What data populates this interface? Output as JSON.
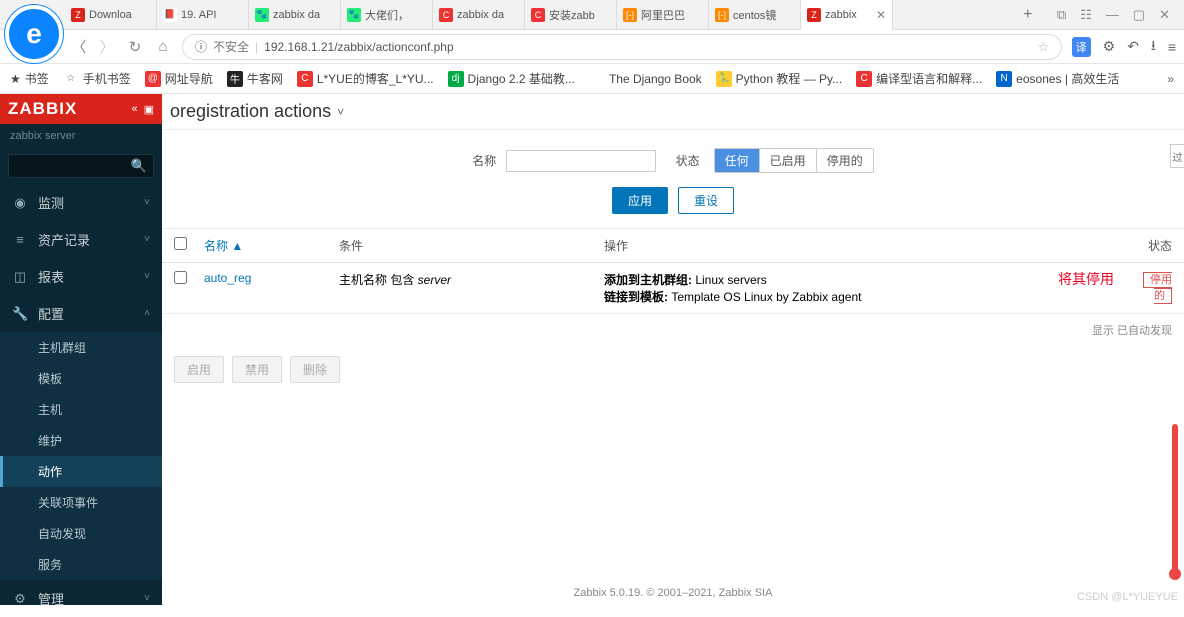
{
  "browser": {
    "tabs": [
      {
        "label": "Downloa",
        "color": "#d9241c",
        "txt": "Z"
      },
      {
        "label": "19. API",
        "color": "#fff",
        "txt": "📕"
      },
      {
        "label": "zabbix da",
        "color": "#2e7",
        "txt": "🐾"
      },
      {
        "label": "大佬们，",
        "color": "#2e7",
        "txt": "🐾"
      },
      {
        "label": "zabbix da",
        "color": "#e33",
        "txt": "C"
      },
      {
        "label": "安装zabb",
        "color": "#e33",
        "txt": "C"
      },
      {
        "label": "阿里巴巴",
        "color": "#f80",
        "txt": "[-]"
      },
      {
        "label": "centos镜",
        "color": "#f80",
        "txt": "[-]"
      },
      {
        "label": "zabbix",
        "color": "#d9241c",
        "txt": "Z",
        "active": true
      }
    ],
    "url_insecure": "不安全",
    "url": "192.168.1.21/zabbix/actionconf.php",
    "bookmarks_label": "书签",
    "bookmarks": [
      {
        "label": "手机书签",
        "color": "",
        "txt": "☆"
      },
      {
        "label": "网址导航",
        "color": "#e33",
        "txt": "@"
      },
      {
        "label": "牛客网",
        "color": "#222",
        "txt": "牛"
      },
      {
        "label": "L*YUE的博客_L*YU...",
        "color": "#e33",
        "txt": "C"
      },
      {
        "label": "Django 2.2 基础教...",
        "color": "#0a4",
        "txt": "dj"
      },
      {
        "label": "The Django Book",
        "color": "#fff",
        "txt": "e"
      },
      {
        "label": "Python 教程 — Py...",
        "color": "#fc3",
        "txt": "🐍"
      },
      {
        "label": "编译型语言和解释...",
        "color": "#e33",
        "txt": "C"
      },
      {
        "label": "eosones | 高效生活",
        "color": "#06c",
        "txt": "N"
      }
    ]
  },
  "sidebar": {
    "logo": "ZABBIX",
    "server": "zabbix server",
    "menu": [
      {
        "icon": "◉",
        "label": "监测",
        "chev": "˅"
      },
      {
        "icon": "≡",
        "label": "资产记录",
        "chev": "˅"
      },
      {
        "icon": "◫",
        "label": "报表",
        "chev": "˅"
      },
      {
        "icon": "🔧",
        "label": "配置",
        "chev": "˄",
        "open": true
      },
      {
        "icon": "⚙",
        "label": "管理",
        "chev": "˅"
      }
    ],
    "config_sub": [
      "主机群组",
      "模板",
      "主机",
      "维护",
      "动作",
      "关联项事件",
      "自动发现",
      "服务"
    ],
    "config_active": "动作"
  },
  "page": {
    "title": "oregistration actions",
    "filter_tab": "过",
    "filter": {
      "name_label": "名称",
      "status_label": "状态",
      "seg": [
        "任何",
        "已启用",
        "停用的"
      ],
      "seg_active": "任何",
      "apply": "应用",
      "reset": "重设"
    },
    "columns": {
      "name": "名称",
      "cond": "条件",
      "op": "操作",
      "status": "状态"
    },
    "sort_indicator": "▲",
    "rows": [
      {
        "name": "auto_reg",
        "cond_prefix": "主机名称 包含 ",
        "cond_value": "server",
        "op1_label": "添加到主机群组: ",
        "op1_value": "Linux servers",
        "op2_label": "链接到模板: ",
        "op2_value": "Template OS Linux by Zabbix agent",
        "status": "停用的"
      }
    ],
    "annotation": "将其停用",
    "table_footer": "显示 已自动发现",
    "bulk": [
      "启用",
      "禁用",
      "删除"
    ],
    "footer": "Zabbix 5.0.19. © 2001–2021, Zabbix SIA",
    "watermark": "CSDN @L*YUEYUE"
  }
}
